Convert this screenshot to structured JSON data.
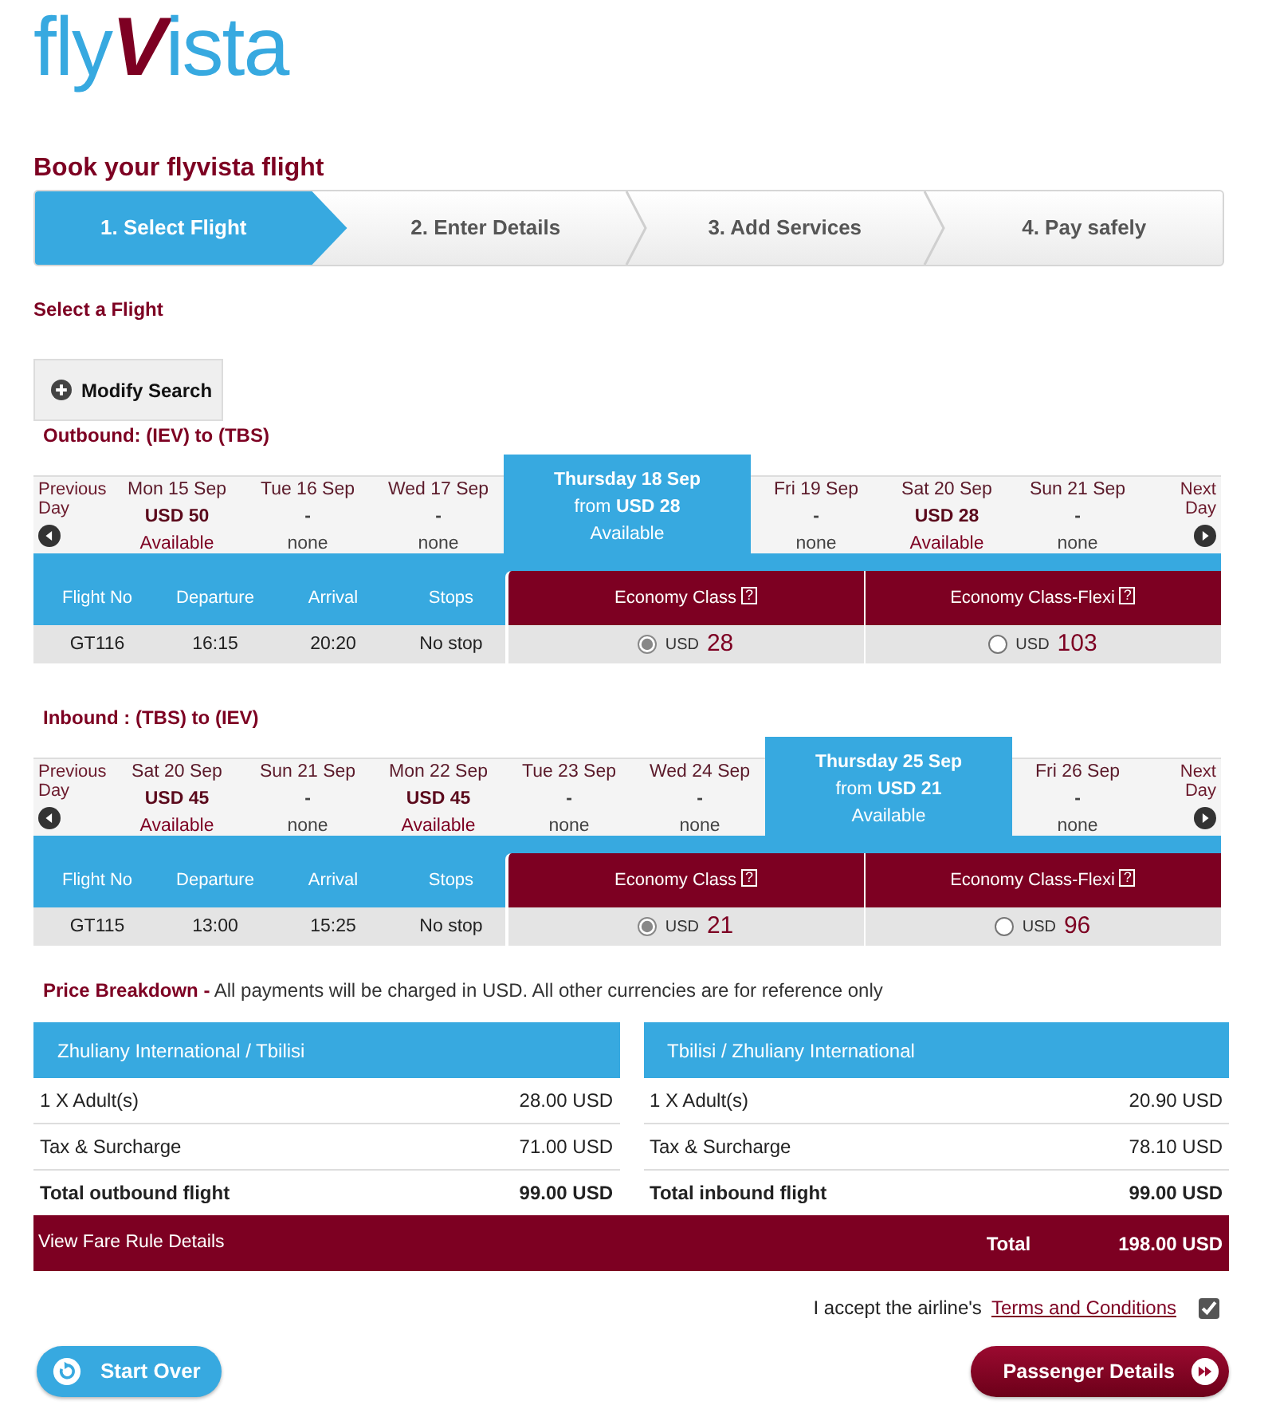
{
  "logo": {
    "text": "fly**V**ista"
  },
  "page_title": "Book your flyvista flight",
  "steps": [
    {
      "label": "1. Select Flight",
      "selected": true
    },
    {
      "label": "2. Enter Details",
      "selected": false
    },
    {
      "label": "3. Add Services",
      "selected": false
    },
    {
      "label": "4. Pay safely",
      "selected": false
    }
  ],
  "section_title": "Select a Flight",
  "modify_search": {
    "label": "Modify Search"
  },
  "journeys": [
    {
      "title": "Outbound: (IEV) to (TBS)",
      "previous": "Previous Day",
      "next": "Next Day",
      "days": [
        {
          "date": "Mon 15 Sep",
          "price": "USD 50",
          "status": "Available",
          "available": true,
          "selected": false
        },
        {
          "date": "Tue 16 Sep",
          "price": "-",
          "status": "none",
          "available": false,
          "selected": false
        },
        {
          "date": "Wed 17 Sep",
          "price": "-",
          "status": "none",
          "available": false,
          "selected": false
        },
        {
          "date": "Thursday 18 Sep",
          "price": "from **USD 28**",
          "status": "Available",
          "available": true,
          "selected": true
        },
        {
          "date": "Fri 19 Sep",
          "price": "-",
          "status": "none",
          "available": false,
          "selected": false
        },
        {
          "date": "Sat 20 Sep",
          "price": "USD 28",
          "status": "Available",
          "available": true,
          "selected": false
        },
        {
          "date": "Sun 21 Sep",
          "price": "-",
          "status": "none",
          "available": false,
          "selected": false
        }
      ],
      "columns": [
        "Flight No",
        "Departure",
        "Arrival",
        "Stops"
      ],
      "classes": [
        {
          "name": "Economy Class",
          "help": "?"
        },
        {
          "name": "Economy Class-Flexi",
          "help": "?"
        }
      ],
      "flights": [
        {
          "flight_no": "GT116",
          "departure": "16:15",
          "arrival": "20:20",
          "stops": "No stop",
          "fares": [
            {
              "currency": "USD",
              "amount": "28",
              "selected": true
            },
            {
              "currency": "USD",
              "amount": "103",
              "selected": false
            }
          ]
        }
      ]
    },
    {
      "title": "Inbound : (TBS) to (IEV)",
      "previous": "Previous Day",
      "next": "Next Day",
      "days": [
        {
          "date": "Sat 20 Sep",
          "price": "USD 45",
          "status": "Available",
          "available": true,
          "selected": false
        },
        {
          "date": "Sun 21 Sep",
          "price": "-",
          "status": "none",
          "available": false,
          "selected": false
        },
        {
          "date": "Mon 22 Sep",
          "price": "USD 45",
          "status": "Available",
          "available": true,
          "selected": false
        },
        {
          "date": "Tue 23 Sep",
          "price": "-",
          "status": "none",
          "available": false,
          "selected": false
        },
        {
          "date": "Wed 24 Sep",
          "price": "-",
          "status": "none",
          "available": false,
          "selected": false
        },
        {
          "date": "Thursday 25 Sep",
          "price": "from **USD 21**",
          "status": "Available",
          "available": true,
          "selected": true
        },
        {
          "date": "Fri 26 Sep",
          "price": "-",
          "status": "none",
          "available": false,
          "selected": false
        }
      ],
      "columns": [
        "Flight No",
        "Departure",
        "Arrival",
        "Stops"
      ],
      "classes": [
        {
          "name": "Economy Class",
          "help": "?"
        },
        {
          "name": "Economy Class-Flexi",
          "help": "?"
        }
      ],
      "flights": [
        {
          "flight_no": "GT115",
          "departure": "13:00",
          "arrival": "15:25",
          "stops": "No stop",
          "fares": [
            {
              "currency": "USD",
              "amount": "21",
              "selected": true
            },
            {
              "currency": "USD",
              "amount": "96",
              "selected": false
            }
          ]
        }
      ]
    }
  ],
  "price_breakdown": {
    "intro": "**Price Breakdown -** All payments will be charged in USD. All other currencies are for reference only",
    "legs": [
      {
        "route": "Zhuliany International / Tbilisi",
        "lines": [
          {
            "label": "1 X Adult(s)",
            "amount": "28.00 USD"
          },
          {
            "label": "Tax & Surcharge",
            "amount": "71.00 USD"
          }
        ],
        "total": {
          "label": "Total outbound flight",
          "amount": "99.00 USD"
        }
      },
      {
        "route": "Tbilisi / Zhuliany International",
        "lines": [
          {
            "label": "1 X Adult(s)",
            "amount": "20.90 USD"
          },
          {
            "label": "Tax & Surcharge",
            "amount": "78.10 USD"
          }
        ],
        "total": {
          "label": "Total inbound flight",
          "amount": "99.00 USD"
        }
      }
    ],
    "fare_rules_link": "View Fare Rule Details",
    "total_label": "Total",
    "total_amount": "198.00 USD"
  },
  "terms": {
    "text": "I accept the airline's",
    "link": "Terms and Conditions",
    "checked": true
  },
  "buttons": [
    {
      "kind": "back",
      "label": "Start Over"
    },
    {
      "kind": "forward",
      "label": "Passenger Details"
    }
  ]
}
